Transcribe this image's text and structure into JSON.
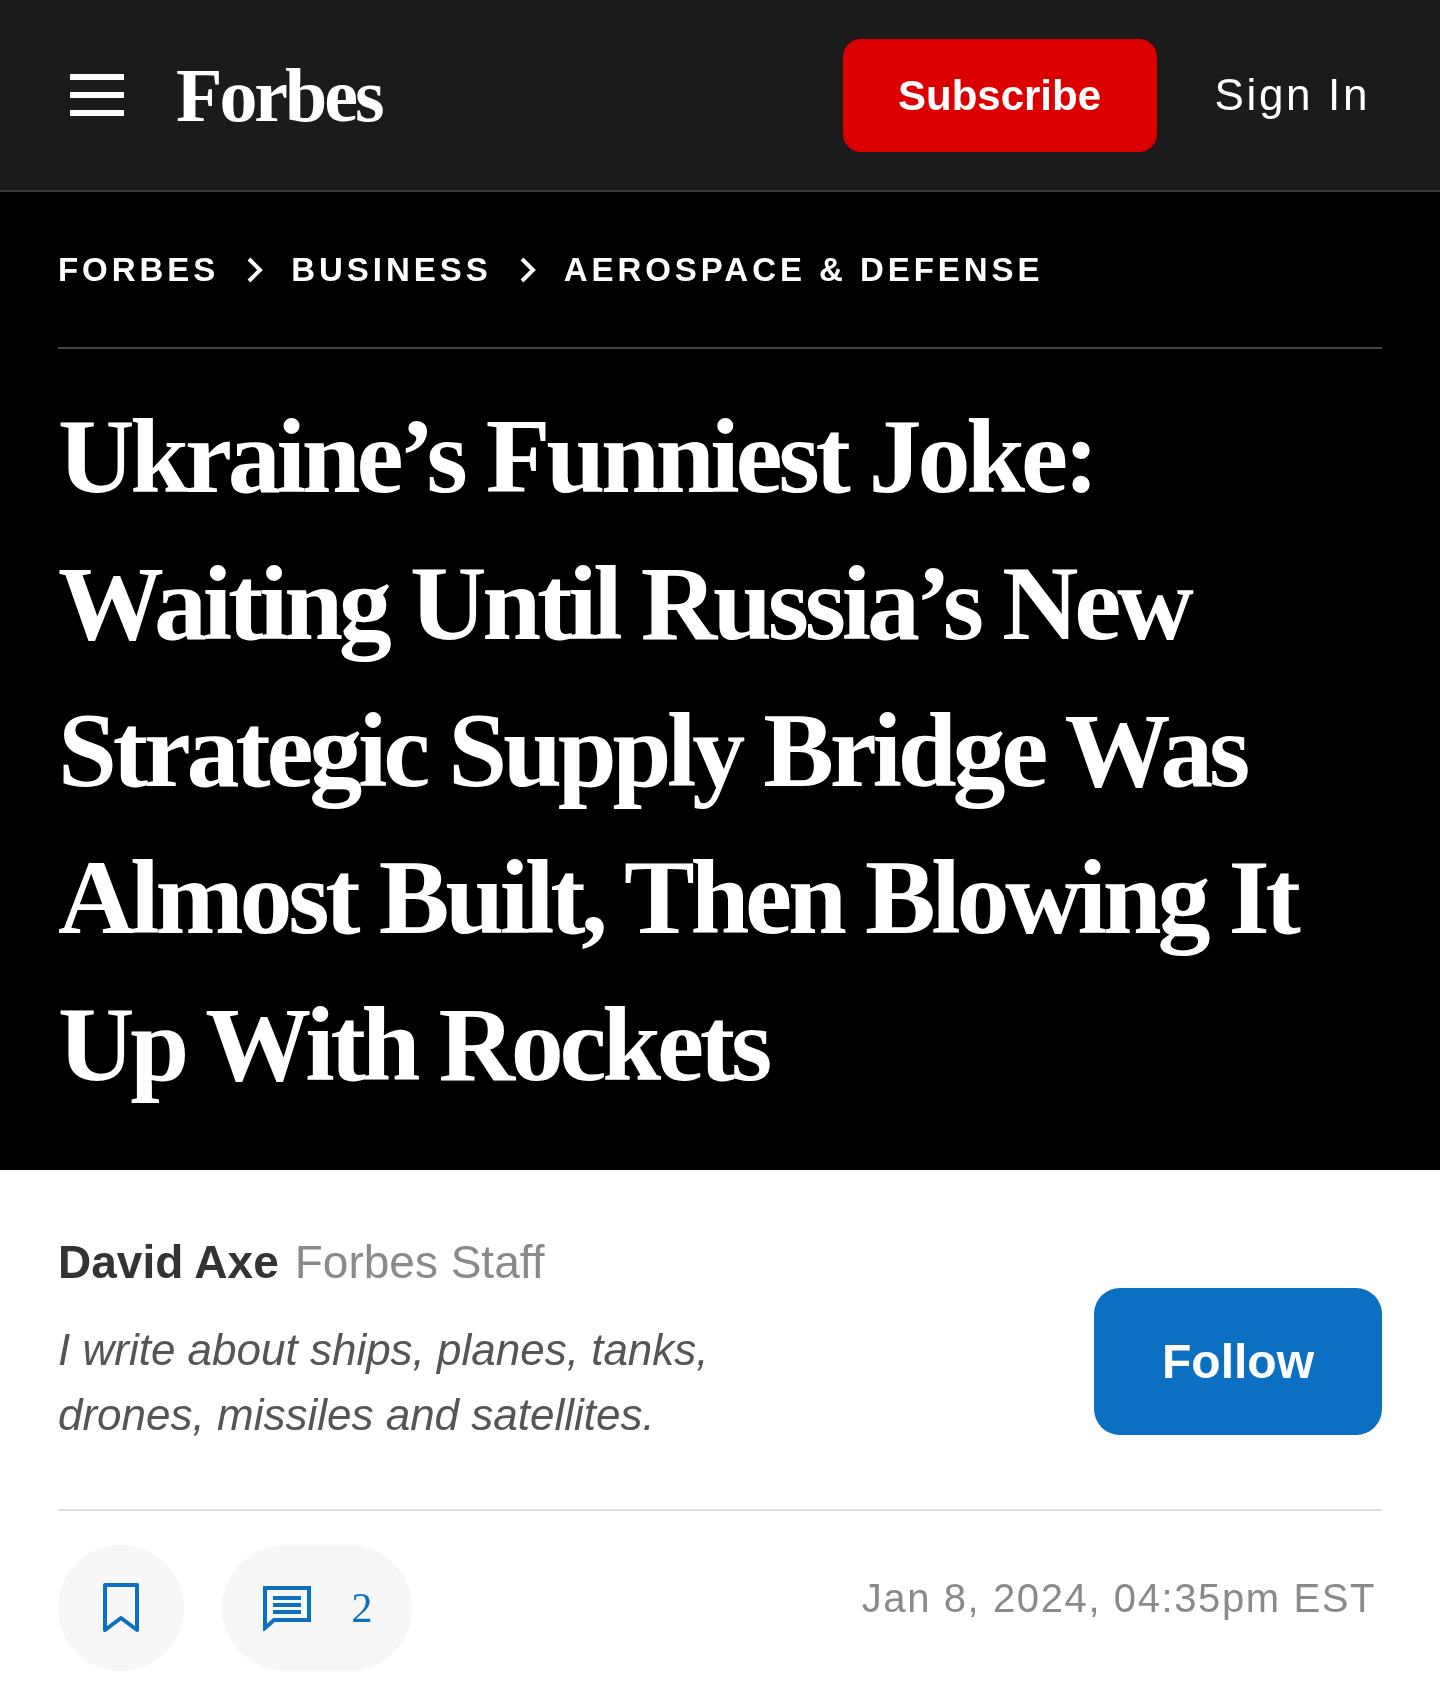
{
  "header": {
    "logo": "Forbes",
    "subscribe": "Subscribe",
    "sign_in": "Sign In"
  },
  "breadcrumbs": [
    "FORBES",
    "BUSINESS",
    "AEROSPACE & DEFENSE"
  ],
  "headline": "Ukraine’s Funniest Joke: Waiting Until Russia’s New Strategic Supply Bridge Was Almost Built, Then Blowing It Up With Rockets",
  "author": {
    "name": "David Axe",
    "role": "Forbes Staff",
    "bio": "I write about ships, planes, tanks, drones, missiles and satellites.",
    "follow": "Follow"
  },
  "actions": {
    "comments": "2",
    "date": "Jan 8, 2024, 04:35pm EST"
  }
}
